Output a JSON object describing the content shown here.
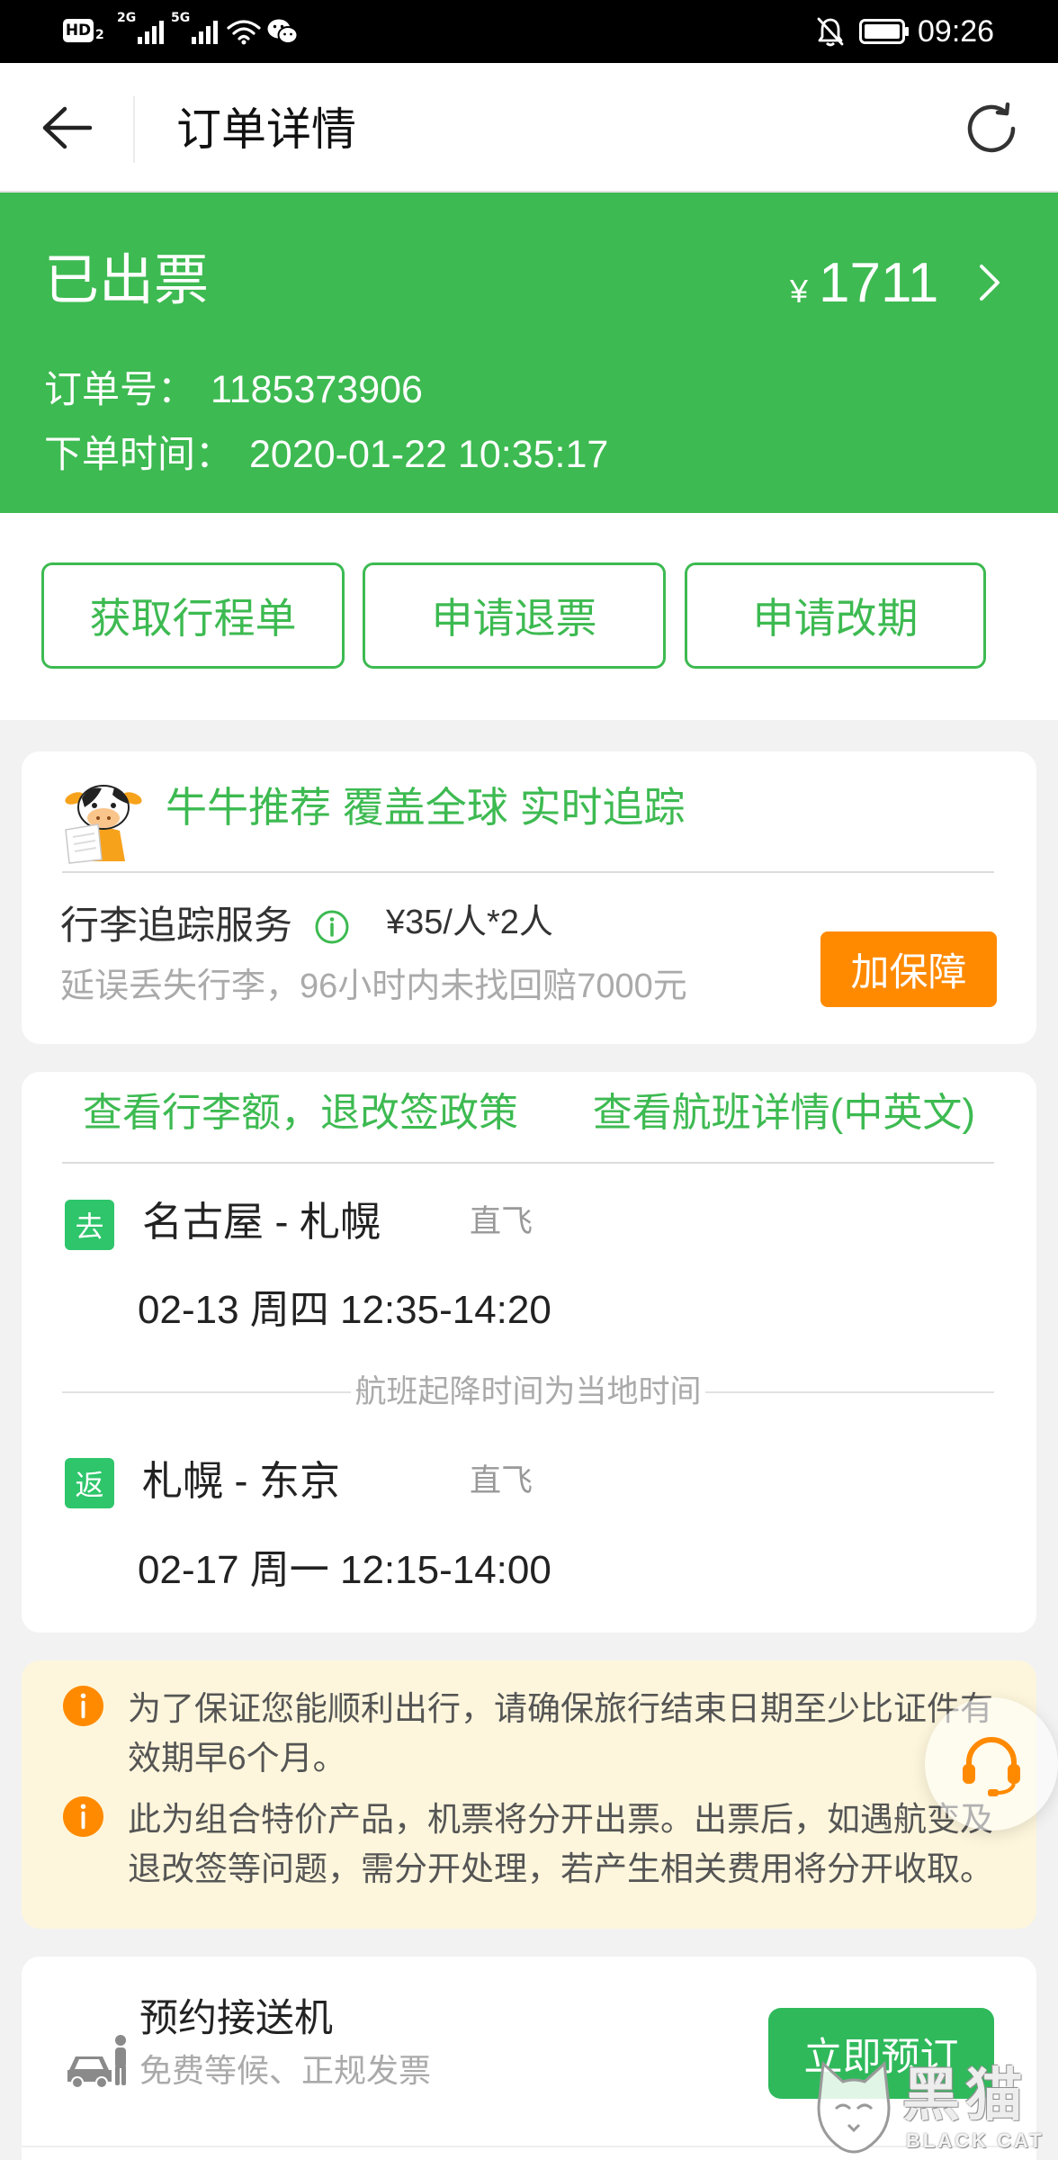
{
  "status_bar": {
    "hd_label": "HD",
    "hd_sim": "2",
    "sim1_network": "2G",
    "sim2_network": "5G",
    "time": "09:26",
    "icons": [
      "hd-icon",
      "signal-icon",
      "signal-icon",
      "wifi-icon",
      "wechat-icon",
      "bell-off-icon",
      "battery-icon"
    ]
  },
  "header": {
    "title": "订单详情",
    "back_icon": "back-arrow-icon",
    "refresh_icon": "refresh-icon"
  },
  "order": {
    "status": "已出票",
    "currency": "¥",
    "amount": "1711",
    "chevron_icon": "chevron-right-icon",
    "order_no_label": "订单号：",
    "order_no": "1185373906",
    "order_time_label": "下单时间：",
    "order_time": "2020-01-22 10:35:17"
  },
  "actions": [
    {
      "label": "获取行程单"
    },
    {
      "label": "申请退票"
    },
    {
      "label": "申请改期"
    }
  ],
  "promo": {
    "mascot_icon": "cow-mascot-icon",
    "headline": "牛牛推荐 覆盖全球 实时追踪",
    "service_name": "行李追踪服务",
    "info_icon": "info-icon",
    "price": "¥35/人*2人",
    "description": "延误丢失行李，96小时内未找回赔7000元",
    "button_label": "加保障"
  },
  "flights": {
    "links": [
      {
        "label": "查看行李额，退改签政策"
      },
      {
        "label": "查看航班详情(中英文)"
      }
    ],
    "segments": [
      {
        "tag": "去",
        "route": "名古屋 - 札幌",
        "type": "直飞",
        "schedule": "02-13 周四 12:35-14:20"
      },
      {
        "tag": "返",
        "route": "札幌 - 东京",
        "type": "直飞",
        "schedule": "02-17 周一 12:15-14:00"
      }
    ],
    "time_note": "航班起降时间为当地时间"
  },
  "notices": [
    {
      "icon": "info-circle-icon",
      "text": "为了保证您能顺利出行，请确保旅行结束日期至少比证件有效期早6个月。"
    },
    {
      "icon": "info-circle-icon",
      "text": "此为组合特价产品，机票将分开出票。出票后，如遇航变及退改签等问题，需分开处理，若产生相关费用将分开收取。"
    }
  ],
  "customer_service": {
    "icon": "headset-icon"
  },
  "transfer": {
    "icon": "car-pickup-icon",
    "title": "预约接送机",
    "subtitle": "免费等候、正规发票",
    "button_label": "立即预订"
  },
  "watermark": {
    "brand_cn": "黑猫",
    "brand_en": "BLACK CAT"
  },
  "colors": {
    "primary_green": "#3dba51",
    "tag_green": "#2ec56b",
    "button_green": "#2fb95b",
    "accent_orange": "#ff8a00",
    "notice_bg": "#fdf6dc",
    "page_bg": "#f2f2f2"
  }
}
